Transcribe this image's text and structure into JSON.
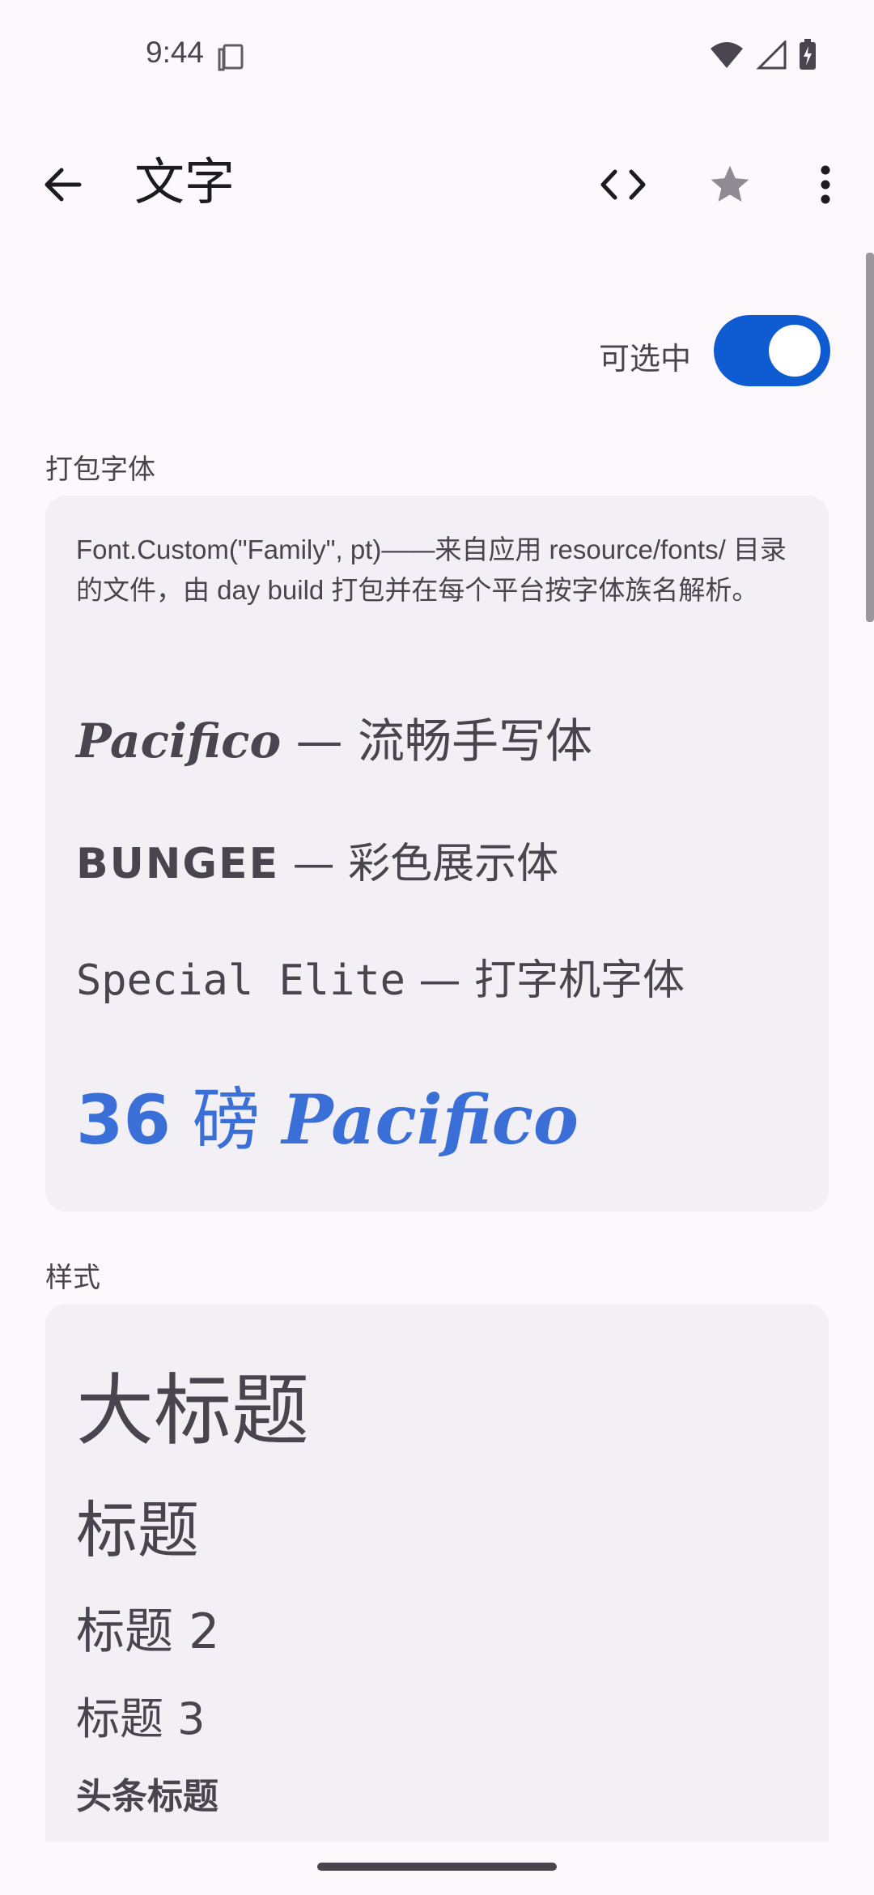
{
  "status_bar": {
    "time": "9:44",
    "icons": [
      "sim-card-icon",
      "wifi-icon",
      "signal-icon",
      "battery-charging-icon"
    ]
  },
  "app_bar": {
    "title": "文字",
    "back_icon": "arrow-back-icon",
    "code_icon": "code-icon",
    "star_icon": "star-icon",
    "more_icon": "more-vert-icon"
  },
  "selectable": {
    "label": "可选中",
    "checked": true
  },
  "packaged_fonts": {
    "section_label": "打包字体",
    "description": "Font.Custom(\"Family\", pt)——来自应用 resource/fonts/ 目录的文件，由 day build 打包并在每个平台按字体族名解析。",
    "lines": [
      {
        "name": "Pacifico",
        "rest": " — 流畅手写体"
      },
      {
        "name": "BUNGEE",
        "rest": " — 彩色展示体"
      },
      {
        "name": "Special Elite",
        "rest": " — 打字机字体"
      }
    ],
    "big_line": {
      "number": "36",
      "unit": " 磅 ",
      "name": "Pacifico"
    },
    "accent_color": "#3a6fd8"
  },
  "styles": {
    "section_label": "样式",
    "items": [
      "大标题",
      "标题",
      "标题 2",
      "标题 3",
      "头条标题"
    ]
  },
  "colors": {
    "background": "#fcf8fc",
    "card": "#f2eff5",
    "toggle_on": "#0f5bd1",
    "text_secondary": "#49454f"
  }
}
